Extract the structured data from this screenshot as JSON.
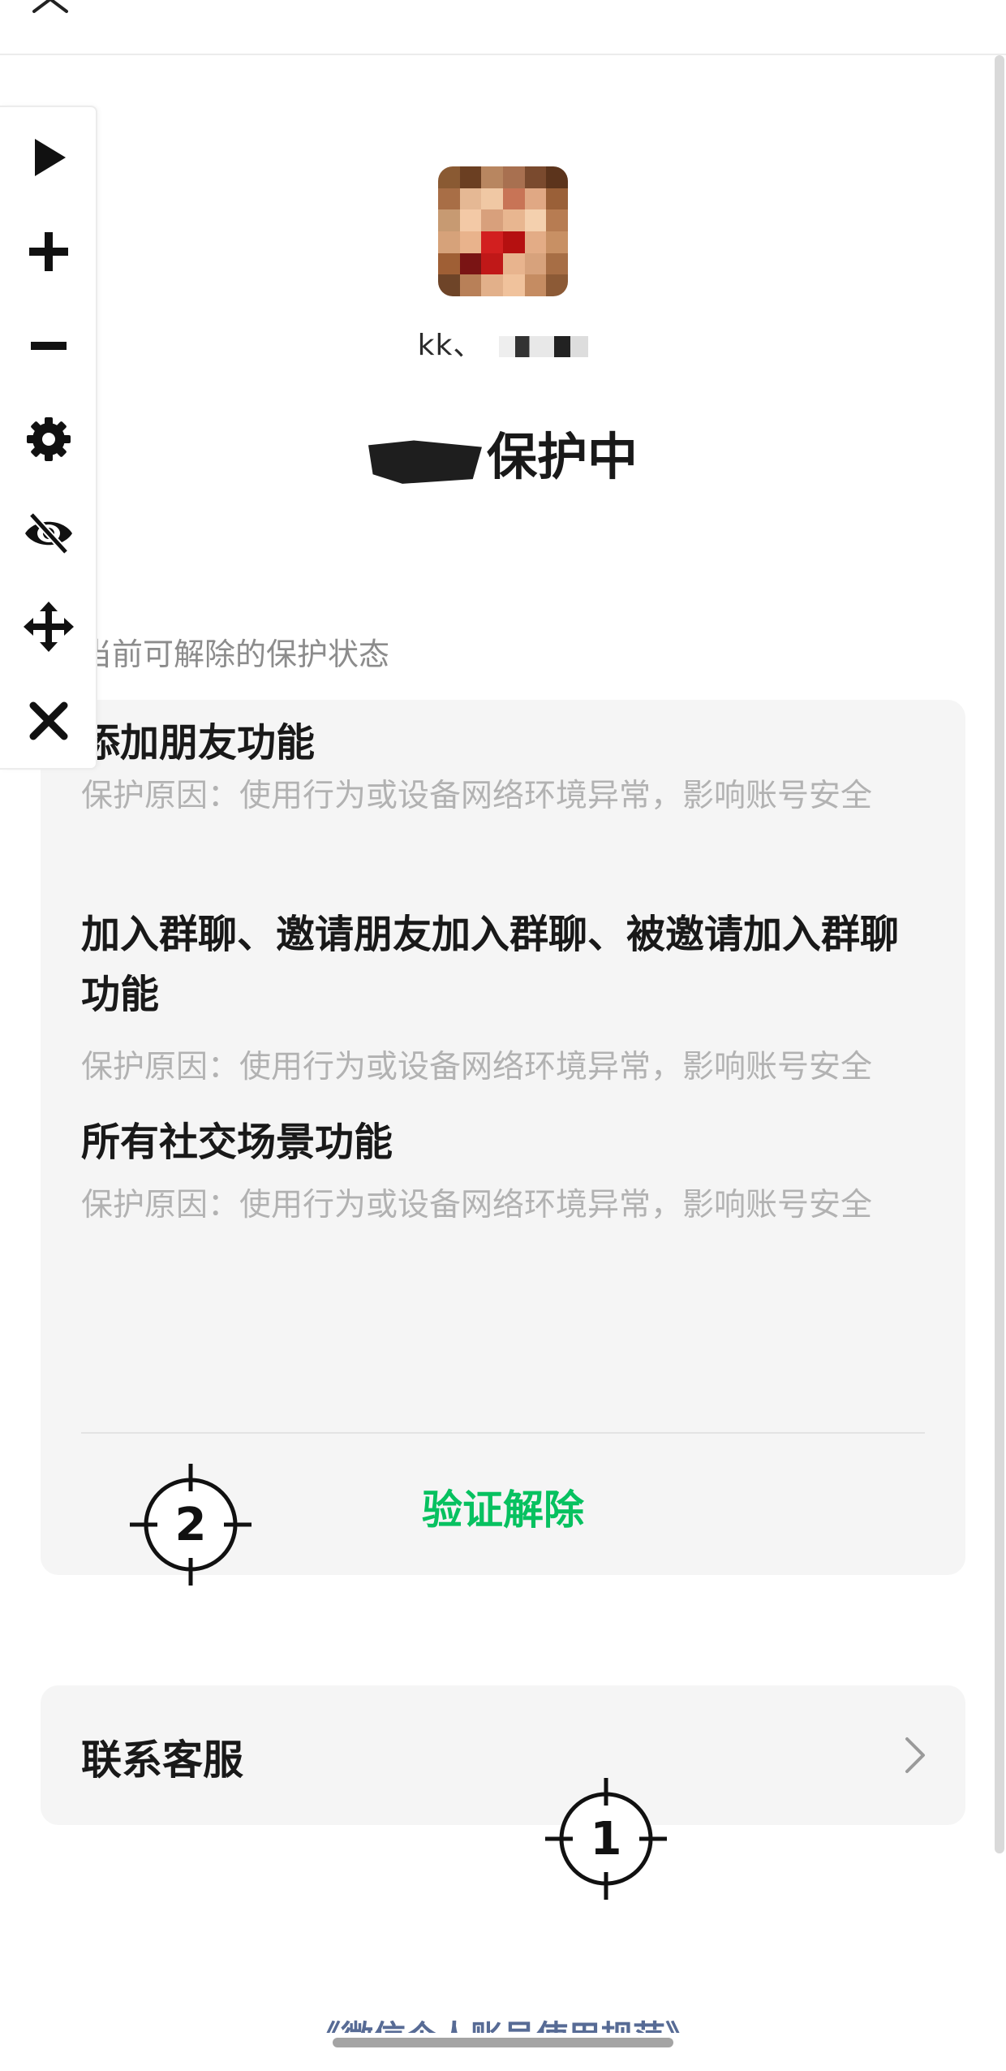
{
  "avatar": {
    "pixels": [
      "#8a5a33",
      "#6b3f22",
      "#b88660",
      "#a87050",
      "#7a4a2e",
      "#5c341c",
      "#a86e46",
      "#e5b894",
      "#f0c8a4",
      "#c87456",
      "#e0a884",
      "#9a6038",
      "#c79a72",
      "#f3c9a6",
      "#d8a07c",
      "#e8b690",
      "#f4d0ae",
      "#b77c52",
      "#d6a27a",
      "#e9b38c",
      "#d21f1f",
      "#b51010",
      "#e3ac86",
      "#c89064",
      "#9f5f35",
      "#7a1414",
      "#c01818",
      "#e8b48e",
      "#d7a27c",
      "#a76e45",
      "#6e4428",
      "#b88058",
      "#e2b08a",
      "#f0c29c",
      "#c58c62",
      "#8c5a36"
    ]
  },
  "user": {
    "name": "kk、"
  },
  "headline": {
    "text": "保护中"
  },
  "section_label": "当前可解除的保护状态",
  "items": [
    {
      "title": "添加朋友功能",
      "reason": "保护原因：使用行为或设备网络环境异常，影响账号安全"
    },
    {
      "title": "加入群聊、邀请朋友加入群聊、被邀请加入群聊功能",
      "reason": "保护原因：使用行为或设备网络环境异常，影响账号安全"
    },
    {
      "title": "所有社交场景功能",
      "reason": "保护原因：使用行为或设备网络环境异常，影响账号安全"
    }
  ],
  "verify_label": "验证解除",
  "contact_label": "联系客服",
  "footer_link": "《微信个人账号使用规范》",
  "markers": [
    {
      "label": "1"
    },
    {
      "label": "2"
    }
  ],
  "colors": {
    "accent": "#07c160",
    "link": "#576b95",
    "reason_text": "#b2b2b2",
    "card_bg": "#f5f5f5"
  },
  "toolbar_icons": [
    "play-icon",
    "plus-icon",
    "minus-icon",
    "gear-icon",
    "eye-off-icon",
    "move-icon",
    "close-icon"
  ]
}
